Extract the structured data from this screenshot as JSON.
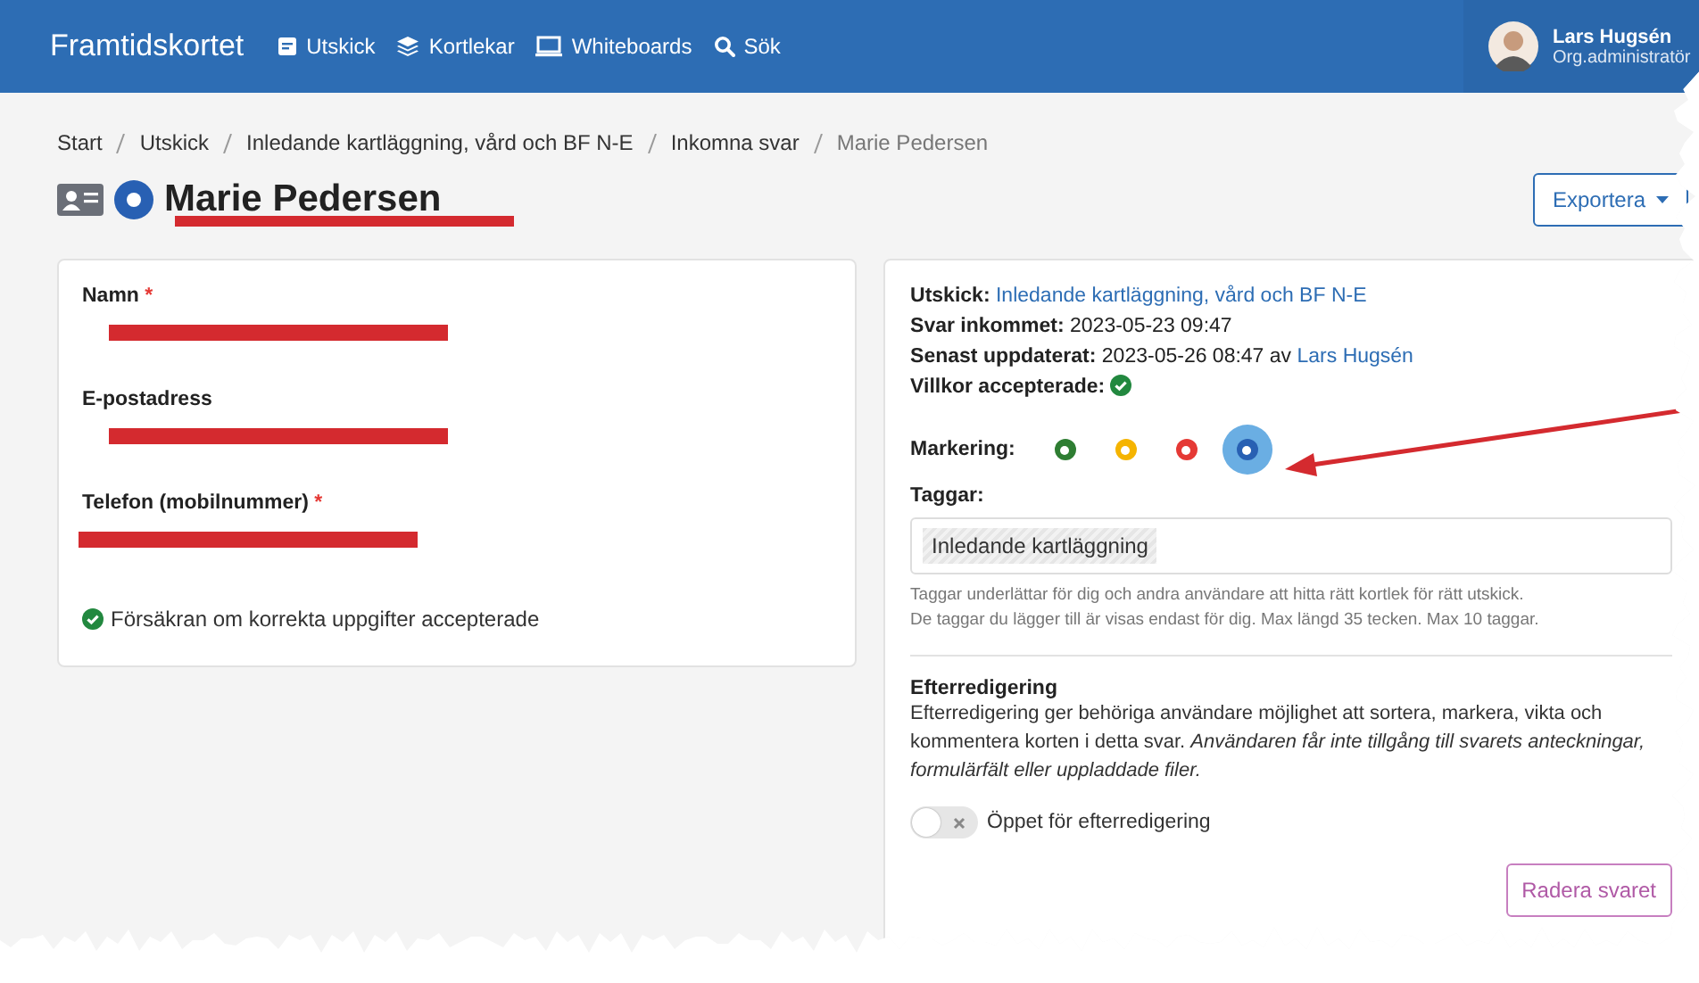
{
  "navbar": {
    "brand": "Framtidskortet",
    "items": [
      {
        "label": "Utskick"
      },
      {
        "label": "Kortlekar"
      },
      {
        "label": "Whiteboards"
      },
      {
        "label": "Sök"
      }
    ],
    "user": {
      "name": "Lars Hugsén",
      "role": "Org.administratör"
    }
  },
  "breadcrumb": [
    {
      "label": "Start",
      "current": false
    },
    {
      "label": "Utskick",
      "current": false
    },
    {
      "label": "Inledande kartläggning, vård och BF N-E",
      "current": false
    },
    {
      "label": "Inkomna svar",
      "current": false
    },
    {
      "label": "Marie Pedersen",
      "current": true
    }
  ],
  "page_title": "Marie Pedersen",
  "export_button": "Exportera",
  "contact_card": {
    "fields": [
      {
        "label": "Namn",
        "required_mark": "*"
      },
      {
        "label": "E-postadress"
      },
      {
        "label": "Telefon (mobilnummer)",
        "required_mark": "*"
      }
    ],
    "confirmation": "Försäkran om korrekta uppgifter accepterade"
  },
  "response_card": {
    "details": [
      {
        "label": "Utskick:",
        "parts": [
          {
            "kind": "link",
            "text": "Inledande kartläggning, vård och BF N-E"
          }
        ]
      },
      {
        "label": "Svar inkommet:",
        "parts": [
          {
            "kind": "text",
            "text": "2023-05-23 09:47"
          }
        ]
      },
      {
        "label": "Senast uppdaterat:",
        "parts": [
          {
            "kind": "text",
            "text": "2023-05-26 08:47 av"
          },
          {
            "kind": "link",
            "text": "Lars Hugsén"
          }
        ]
      },
      {
        "label": "Villkor accepterade:",
        "accepted": true
      }
    ],
    "marking": {
      "label": "Markering:",
      "options": [
        {
          "color": "#2e7d32",
          "selected": false
        },
        {
          "color": "#f5b400",
          "selected": false
        },
        {
          "color": "#e53935",
          "selected": false
        },
        {
          "color": "#2860b3",
          "selected": true
        }
      ]
    },
    "tags": {
      "label": "Taggar:",
      "items": [
        "Inledande kartläggning"
      ],
      "help": [
        "Taggar underlättar för dig och andra användare att hitta rätt kortlek för rätt utskick.",
        "De taggar du lägger till är visas endast för dig. Max längd 35 tecken. Max 10 taggar."
      ]
    },
    "post_edit": {
      "title": "Efterredigering",
      "text": "Efterredigering ger behöriga användare möjlighet att sortera, markera, vikta och kommentera korten i detta svar. *Användaren får inte tillgång till svarets anteckningar, formulärfält eller uppladdade filer.*",
      "toggle": {
        "label": "Öppet för efterredigering",
        "on": false
      }
    },
    "delete_button": "Radera svaret"
  }
}
